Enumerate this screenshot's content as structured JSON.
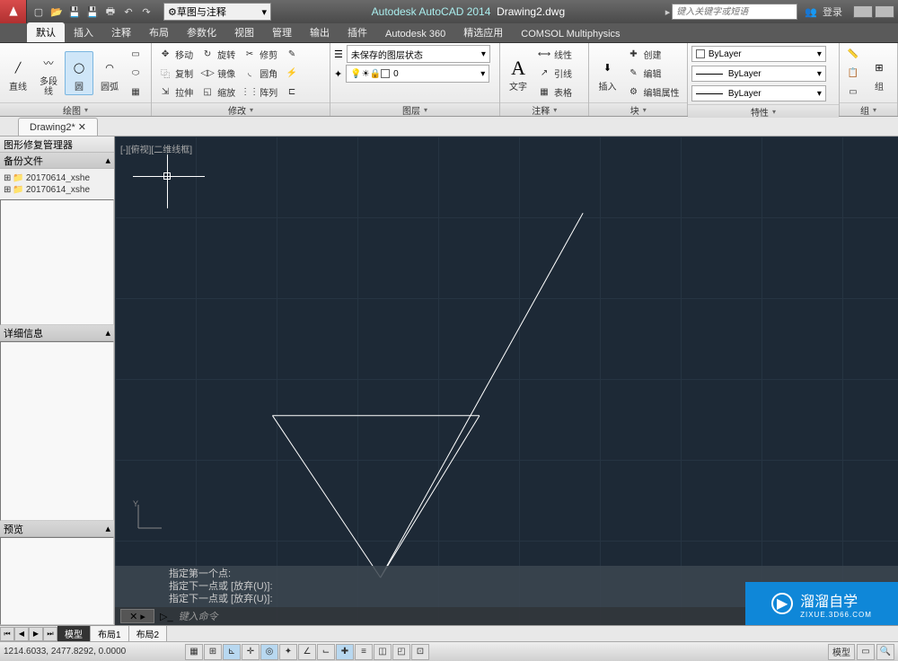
{
  "titlebar": {
    "workspace": "草图与注释",
    "app": "Autodesk AutoCAD 2014",
    "file": "Drawing2.dwg",
    "search_placeholder": "键入关键字或短语",
    "login": "登录"
  },
  "ribbon_tabs": [
    "默认",
    "插入",
    "注释",
    "布局",
    "参数化",
    "视图",
    "管理",
    "输出",
    "插件",
    "Autodesk 360",
    "精选应用",
    "COMSOL Multiphysics"
  ],
  "ribbon": {
    "draw": {
      "title": "绘图",
      "items": [
        "直线",
        "多段线",
        "圆",
        "圆弧"
      ]
    },
    "modify": {
      "title": "修改",
      "rows": [
        [
          "移动",
          "旋转",
          "修剪"
        ],
        [
          "复制",
          "镜像",
          "圆角"
        ],
        [
          "拉伸",
          "缩放",
          "阵列"
        ]
      ]
    },
    "layers": {
      "title": "图层",
      "state": "未保存的图层状态",
      "current": "0"
    },
    "annot": {
      "title": "注释",
      "text": "文字",
      "items": [
        "线性",
        "引线",
        "表格"
      ]
    },
    "block": {
      "title": "块",
      "insert": "插入",
      "items": [
        "创建",
        "编辑",
        "编辑属性"
      ]
    },
    "props": {
      "title": "特性",
      "bylayer": "ByLayer"
    },
    "group": {
      "title": "组",
      "btn": "组"
    }
  },
  "file_tab": "Drawing2*",
  "side": {
    "title": "图形修复管理器",
    "backup": "备份文件",
    "files": [
      "20170614_xshe",
      "20170614_xshe"
    ],
    "detail": "详细信息",
    "preview": "预览"
  },
  "viewport": "[-][俯视][二维线框]",
  "ucs": "Y",
  "cmd": {
    "hist": [
      "指定第一个点:",
      "指定下一点或 [放弃(U)]:",
      "指定下一点或 [放弃(U)]:"
    ],
    "prompt": "键入命令"
  },
  "model_tabs": [
    "模型",
    "布局1",
    "布局2"
  ],
  "status": {
    "coords": "1214.6033, 2477.8292, 0.0000",
    "right": "模型"
  },
  "watermark": {
    "main": "溜溜自学",
    "sub": "ZIXUE.3D66.COM"
  }
}
